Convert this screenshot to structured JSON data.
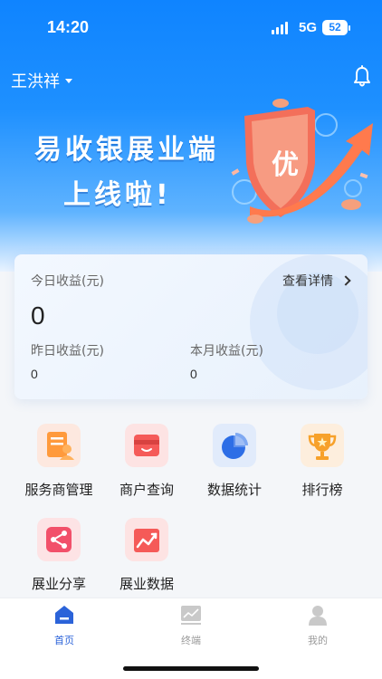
{
  "status_bar": {
    "time": "14:20",
    "network": "5G",
    "battery": "52"
  },
  "header": {
    "user_name": "王洪祥"
  },
  "banner": {
    "line1": "易收银展业端",
    "line2": "上线啦!",
    "shield_text": "优"
  },
  "income": {
    "today_label": "今日收益(元)",
    "today_value": "0",
    "detail_link": "查看详情",
    "yesterday_label": "昨日收益(元)",
    "yesterday_value": "0",
    "month_label": "本月收益(元)",
    "month_value": "0"
  },
  "menu": [
    {
      "label": "服务商管理",
      "icon": "service-provider-icon",
      "color": "#fde8df"
    },
    {
      "label": "商户查询",
      "icon": "merchant-wallet-icon",
      "color": "#fde3e3"
    },
    {
      "label": "数据统计",
      "icon": "pie-chart-icon",
      "color": "#e1ebfb"
    },
    {
      "label": "排行榜",
      "icon": "trophy-icon",
      "color": "#fdeedd"
    },
    {
      "label": "展业分享",
      "icon": "share-icon",
      "color": "#fde3e5"
    },
    {
      "label": "展业数据",
      "icon": "trend-chart-icon",
      "color": "#fde3e3"
    }
  ],
  "tabs": [
    {
      "label": "首页",
      "icon": "home-icon",
      "active": true
    },
    {
      "label": "终端",
      "icon": "terminal-icon",
      "active": false
    },
    {
      "label": "我的",
      "icon": "profile-icon",
      "active": false
    }
  ],
  "colors": {
    "primary": "#1a84ff",
    "active_tab": "#2b63d9",
    "inactive_tab": "#9a9a9a"
  }
}
